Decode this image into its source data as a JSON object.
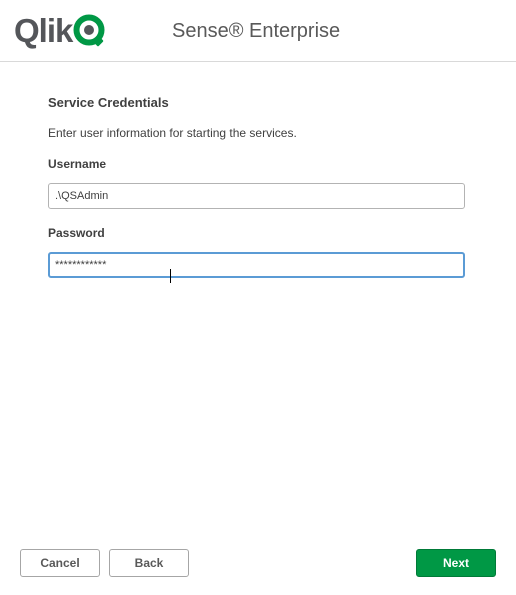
{
  "header": {
    "logo_text": "Qlik",
    "product_title": "Sense® Enterprise",
    "logo_icon": "qlik-q-logo",
    "brand_green": "#009845",
    "brand_gray": "#54565a"
  },
  "main": {
    "section_title": "Service Credentials",
    "instruction": "Enter user information for starting the services.",
    "username": {
      "label": "Username",
      "value": ".\\QSAdmin"
    },
    "password": {
      "label": "Password",
      "value": "************"
    }
  },
  "footer": {
    "cancel_label": "Cancel",
    "back_label": "Back",
    "next_label": "Next"
  },
  "colors": {
    "primary_button": "#009845",
    "focus_border": "#5b9bd5"
  }
}
